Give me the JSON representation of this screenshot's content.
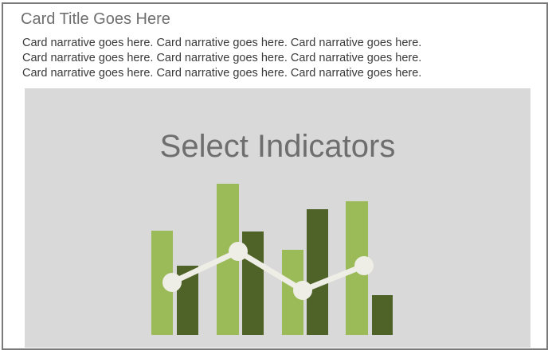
{
  "card": {
    "title": "Card Title Goes Here",
    "narrative_lines": [
      "Card narrative goes here. Card narrative goes here. Card narrative goes here.",
      "Card narrative goes here. Card narrative goes here. Card narrative goes here.",
      "Card narrative goes here. Card narrative goes here. Card narrative goes here."
    ]
  },
  "placeholder": {
    "label": "Select Indicators",
    "icon": "bar-line-chart-icon"
  },
  "colors": {
    "card_border": "#7a7a7a",
    "panel_background": "#d9d9d9",
    "bar_light_green": "#9bbb59",
    "bar_dark_green": "#4f6228",
    "line_marker": "#efeee6"
  }
}
